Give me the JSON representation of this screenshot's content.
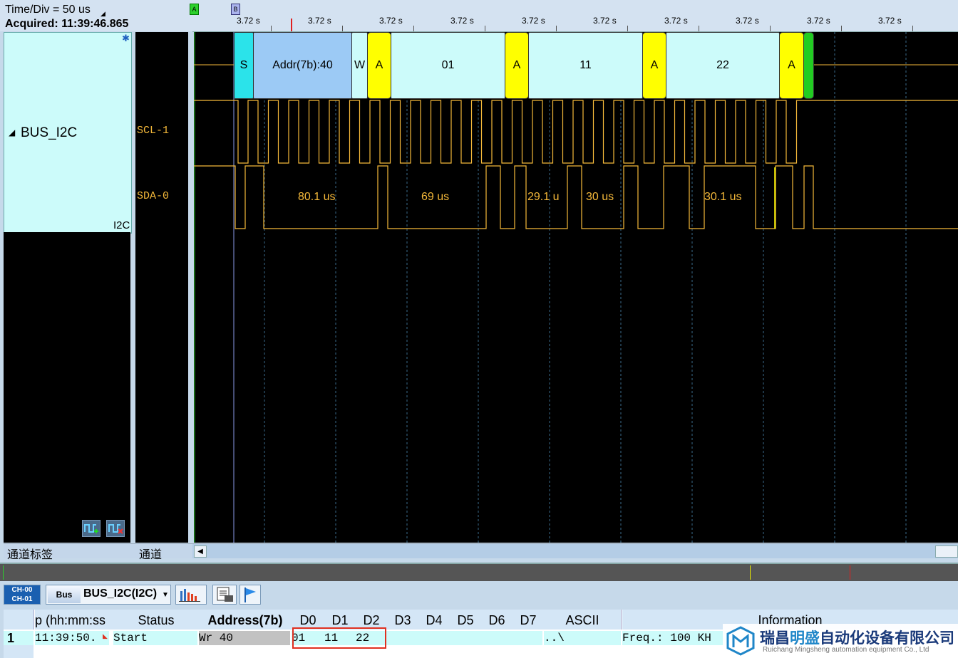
{
  "header": {
    "time_div": "Time/Div = 50 us",
    "acquired": "Acquired: 11:39:46.865"
  },
  "ruler": {
    "tick_label": "3.72 s",
    "tick_count": 10,
    "marker_a": "A",
    "marker_b": "B"
  },
  "channel": {
    "bus_name": "BUS_I2C",
    "protocol_tag": "I2C",
    "lines": [
      "SCL-1",
      "SDA-0"
    ]
  },
  "decode": {
    "segments": [
      {
        "label": "S",
        "color": "#2be3ea"
      },
      {
        "label": "Addr(7b):40",
        "color": "#9ccaf5"
      },
      {
        "label": "W",
        "color": "#ccfbfa"
      },
      {
        "label": "A",
        "color": "#ffff00"
      },
      {
        "label": "01",
        "color": "#ccfbfa"
      },
      {
        "label": "A",
        "color": "#ffff00"
      },
      {
        "label": "11",
        "color": "#ccfbfa"
      },
      {
        "label": "A",
        "color": "#ffff00"
      },
      {
        "label": "22",
        "color": "#ccfbfa"
      },
      {
        "label": "A",
        "color": "#ffff00"
      },
      {
        "label": "",
        "color": "#22cc22"
      }
    ]
  },
  "sda_measurements": [
    "80.1 us",
    "69 us",
    "29.1 u",
    "30 us",
    "30.1 us"
  ],
  "labels_bar": {
    "left": "通道标签",
    "right": "通道"
  },
  "toolbar": {
    "ch00": "CH-00",
    "ch01": "CH-01",
    "bus_icon": "Bus",
    "bus_select": "BUS_I2C(I2C)"
  },
  "table": {
    "headers": [
      "p (hh:mm:ss",
      "Status",
      "Address(7b)",
      "D0",
      "D1",
      "D2",
      "D3",
      "D4",
      "D5",
      "D6",
      "D7",
      "ASCII",
      "Information"
    ],
    "row": {
      "index": "1",
      "time": "11:39:50.",
      "status": "Start",
      "address": "Wr 40",
      "d0": "01",
      "d1": "11",
      "d2": "22",
      "ascii": "..\\",
      "info": "Freq.: 100 KH"
    }
  },
  "watermark": {
    "name_cn_1": "瑞昌",
    "name_cn_2": "明盛",
    "name_cn_3": "自动化设备有限公司",
    "name_en": "Ruichang Mingsheng automation equipment Co., Ltd"
  },
  "colors": {
    "trace": "#f5b93a",
    "highlight_box": "#e03020",
    "grid_dash": "#3a6a8a"
  }
}
